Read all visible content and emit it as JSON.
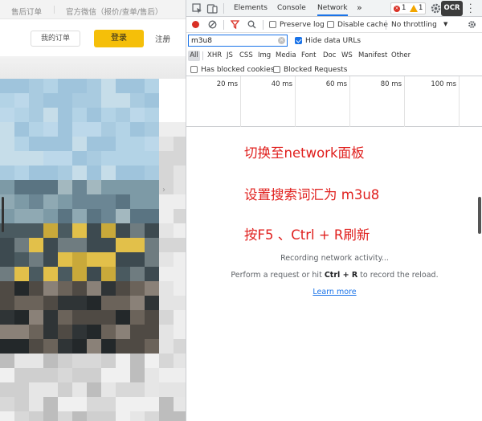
{
  "site": {
    "topbar": {
      "after_sales": "售后订单",
      "wechat": "官方微信（报价/查单/售后）"
    },
    "header": {
      "my_orders": "我的订单",
      "login": "登录",
      "register": "注册"
    }
  },
  "devtools": {
    "tabs": [
      "Elements",
      "Console",
      "Network"
    ],
    "active_tab": "Network",
    "more_tabs": "»",
    "errors": "1",
    "warnings": "1",
    "ocr_label": "OCR",
    "toolbar": {
      "preserve_log": "Preserve log",
      "disable_cache": "Disable cache",
      "throttling": "No throttling",
      "throttling_arrow": "▼"
    },
    "filter": {
      "value": "m3u8",
      "hide_data_urls": "Hide data URLs",
      "hide_data_urls_checked": true
    },
    "types": [
      "All",
      "XHR",
      "JS",
      "CSS",
      "Img",
      "Media",
      "Font",
      "Doc",
      "WS",
      "Manifest",
      "Other"
    ],
    "extra": {
      "has_blocked_cookies": "Has blocked cookies",
      "blocked_requests": "Blocked Requests"
    },
    "timeline_ticks": [
      "20 ms",
      "40 ms",
      "60 ms",
      "80 ms",
      "100 ms"
    ],
    "annotations": {
      "step1": "切换至network面板",
      "step2": "设置搜索词汇为 m3u8",
      "step3": "按F5 、Ctrl + R刷新"
    },
    "empty_state": {
      "recording": "Recording network activity...",
      "perform_prefix": "Perform a request or hit ",
      "perform_keys": "Ctrl + R",
      "perform_suffix": " to record the reload.",
      "learn_more": "Learn more"
    }
  },
  "colors": {
    "accent": "#1a73e8",
    "annotation_red": "#e0201e",
    "login_yellow": "#f5bf09",
    "record_red": "#d93025"
  }
}
